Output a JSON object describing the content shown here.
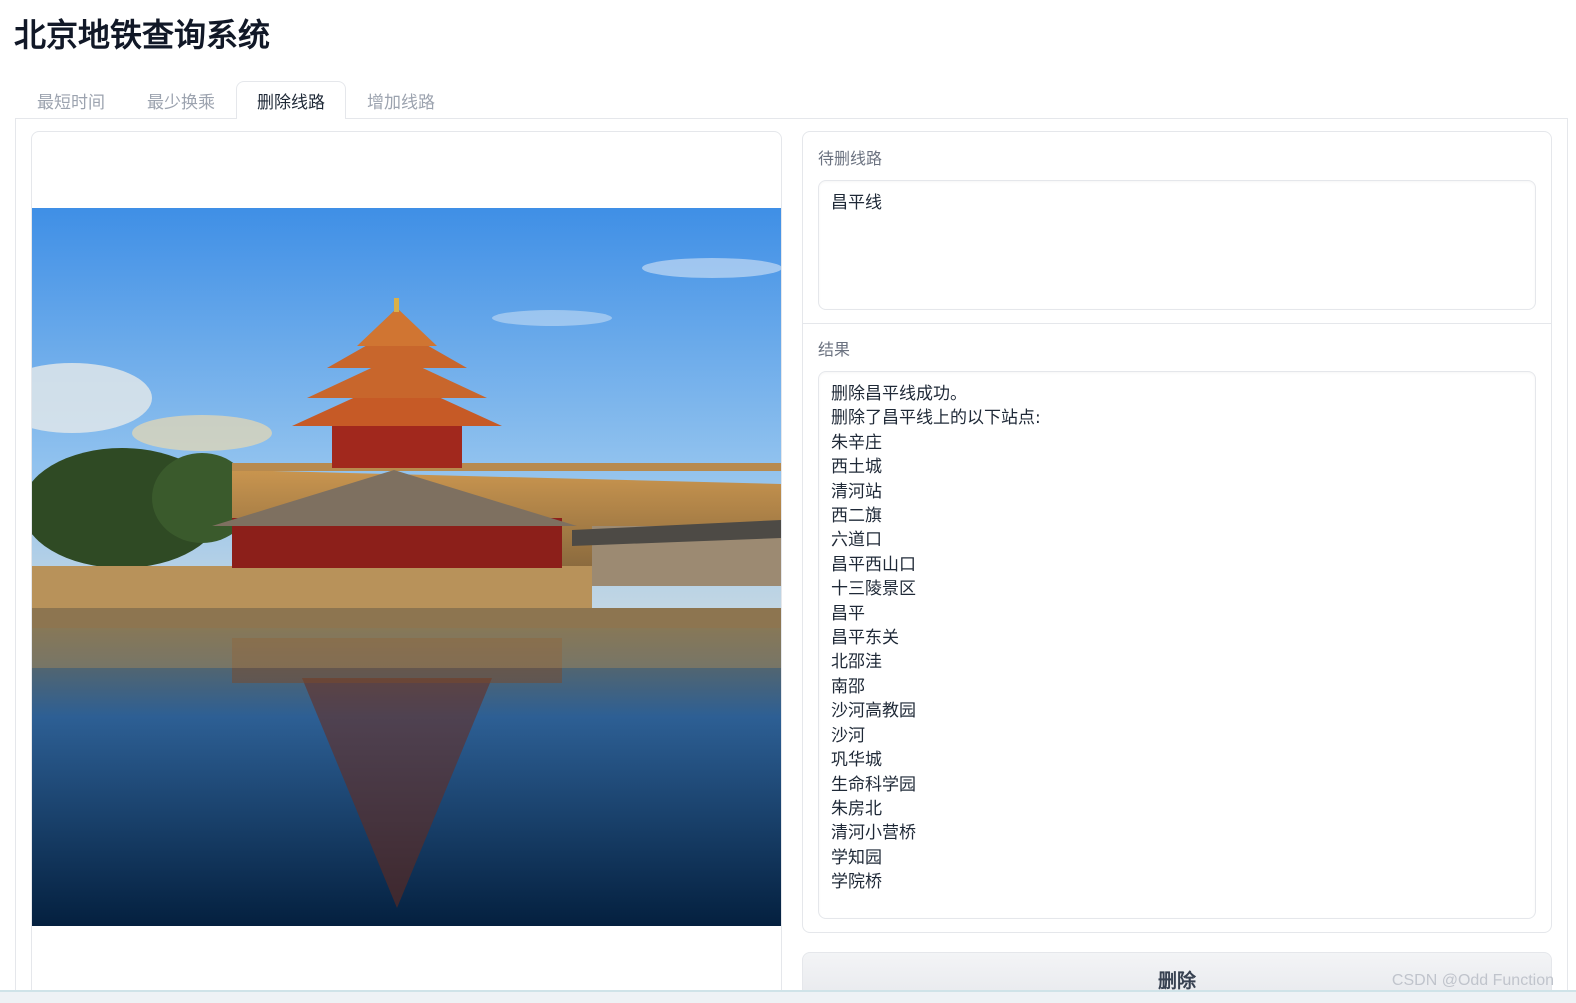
{
  "app": {
    "title": "北京地铁查询系统"
  },
  "tabs": [
    {
      "label": "最短时间",
      "active": false
    },
    {
      "label": "最少换乘",
      "active": false
    },
    {
      "label": "删除线路",
      "active": true
    },
    {
      "label": "增加线路",
      "active": false
    }
  ],
  "form": {
    "line_label": "待删线路",
    "line_value": "昌平线",
    "result_label": "结果",
    "result_lines": [
      "删除昌平线成功。",
      "删除了昌平线上的以下站点:",
      "朱辛庄",
      "西土城",
      "清河站",
      "西二旗",
      "六道口",
      "昌平西山口",
      "十三陵景区",
      "昌平",
      "昌平东关",
      "北邵洼",
      "南邵",
      "沙河高教园",
      "沙河",
      "巩华城",
      "生命科学园",
      "朱房北",
      "清河小营桥",
      "学知园",
      "学院桥"
    ],
    "delete_label": "删除"
  },
  "watermark": "CSDN @Odd Function",
  "colors": {
    "accent": "#1f2937",
    "border": "#e5e7eb",
    "muted": "#9ca3af"
  }
}
